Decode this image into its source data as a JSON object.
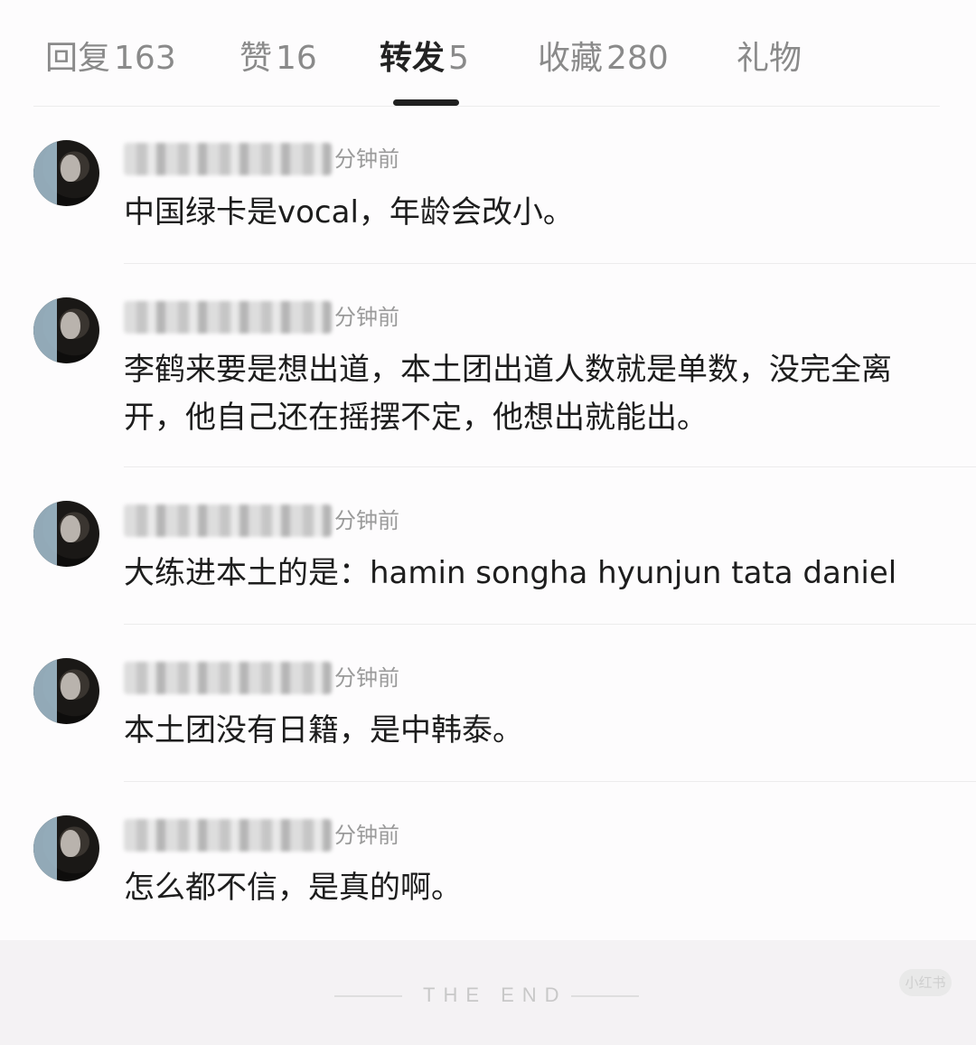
{
  "tabs": [
    {
      "label": "回复",
      "count": "163"
    },
    {
      "label": "赞",
      "count": "16"
    },
    {
      "label": "转发",
      "count": "5"
    },
    {
      "label": "收藏",
      "count": "280"
    },
    {
      "label": "礼物",
      "count": ""
    }
  ],
  "active_tab": "转发",
  "comments": [
    {
      "time": "分钟前",
      "text": "中国绿卡是vocal，年龄会改小。"
    },
    {
      "time": "分钟前",
      "text": "李鹤来要是想出道，本土团出道人数就是单数，没完全离开，他自己还在摇摆不定，他想出就能出。"
    },
    {
      "time": "分钟前",
      "text": "大练进本土的是：hamin songha hyunjun tata daniel"
    },
    {
      "time": "分钟前",
      "text": "本土团没有日籍，是中韩泰。"
    },
    {
      "time": "分钟前",
      "text": "怎么都不信，是真的啊。"
    }
  ],
  "footer": {
    "end_text": "THE END",
    "watermark": "小红书"
  }
}
